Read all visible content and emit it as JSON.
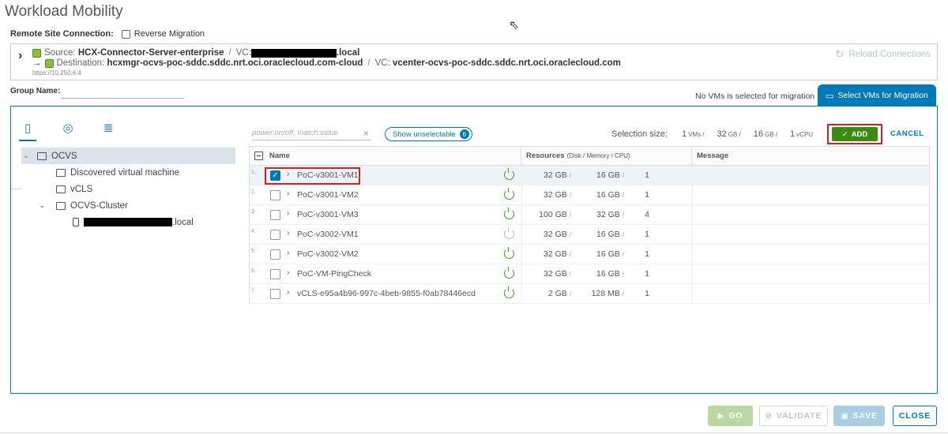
{
  "title": "Workload Mobility",
  "remote_site": {
    "label": "Remote Site Connection:",
    "reverse_label": "Reverse Migration"
  },
  "connection": {
    "source_label": "Source:",
    "source_name": "HCX-Connector-Server-enterprise",
    "vc_label": "VC:",
    "source_vc_suffix": ".local",
    "arrow": "→",
    "dest_label": "Destination:",
    "dest_name": "hcxmgr-ocvs-poc-sddc.sddc.nrt.oci.oraclecloud.com-cloud",
    "dest_vc": "vcenter-ocvs-poc-sddc.sddc.nrt.oci.oraclecloud.com",
    "url": "https://10.250.6.4",
    "reload_label": "Reload Connections"
  },
  "group": {
    "label": "Group Name:",
    "value": ""
  },
  "status": {
    "no_vms": "No VMs is selected for migration",
    "select_tab": "Select VMs for Migration"
  },
  "tree": {
    "root": "OCVS",
    "items": [
      {
        "label": "Discovered virtual machine"
      },
      {
        "label": "vCLS"
      },
      {
        "label": "OCVS-Cluster"
      },
      {
        "label": ".local"
      }
    ]
  },
  "toolbar": {
    "filter_placeholder": "power:on/off, match:value",
    "show_unselectable": "Show unselectable",
    "unselectable_count": "6",
    "selection_size_label": "Selection size:",
    "sel_vms": "1",
    "sel_vms_unit": "VMs /",
    "sel_disk": "32",
    "sel_disk_unit": "GB /",
    "sel_mem": "16",
    "sel_mem_unit": "GB /",
    "sel_cpu": "1",
    "sel_cpu_unit": "vCPU",
    "add_label": "ADD",
    "cancel_label": "CANCEL"
  },
  "grid": {
    "columns": {
      "name": "Name",
      "resources": "Resources",
      "resources_sub": "(Disk / Memory / CPU)",
      "message": "Message"
    },
    "rows": [
      {
        "num": "1.",
        "name": "PoC-v3001-VM1",
        "disk": "32 GB",
        "mem": "16 GB",
        "cpu": "1",
        "checked": true,
        "power": "on"
      },
      {
        "num": "2.",
        "name": "PoC-v3001-VM2",
        "disk": "32 GB",
        "mem": "16 GB",
        "cpu": "1",
        "checked": false,
        "power": "on"
      },
      {
        "num": "3.",
        "name": "PoC-v3001-VM3",
        "disk": "100 GB",
        "mem": "32 GB",
        "cpu": "4",
        "checked": false,
        "power": "on"
      },
      {
        "num": "4.",
        "name": "PoC-v3002-VM1",
        "disk": "32 GB",
        "mem": "16 GB",
        "cpu": "1",
        "checked": false,
        "power": "off"
      },
      {
        "num": "5.",
        "name": "PoC-v3002-VM2",
        "disk": "32 GB",
        "mem": "16 GB",
        "cpu": "1",
        "checked": false,
        "power": "on"
      },
      {
        "num": "6.",
        "name": "PoC-VM-PingCheck",
        "disk": "32 GB",
        "mem": "16 GB",
        "cpu": "1",
        "checked": false,
        "power": "on"
      },
      {
        "num": "7.",
        "name": "vCLS-e95a4b96-997c-4beb-9855-f0ab78446ecd",
        "disk": "2 GB",
        "mem": "128 MB",
        "cpu": "1",
        "checked": false,
        "power": "on"
      }
    ]
  },
  "footer": {
    "go": "GO",
    "validate": "VALIDATE",
    "save": "SAVE",
    "close": "CLOSE"
  },
  "colors": {
    "accent": "#0079b8",
    "add_green": "#3a8b0f",
    "highlight_red": "#d42020",
    "power_on": "#3d9c1e"
  }
}
